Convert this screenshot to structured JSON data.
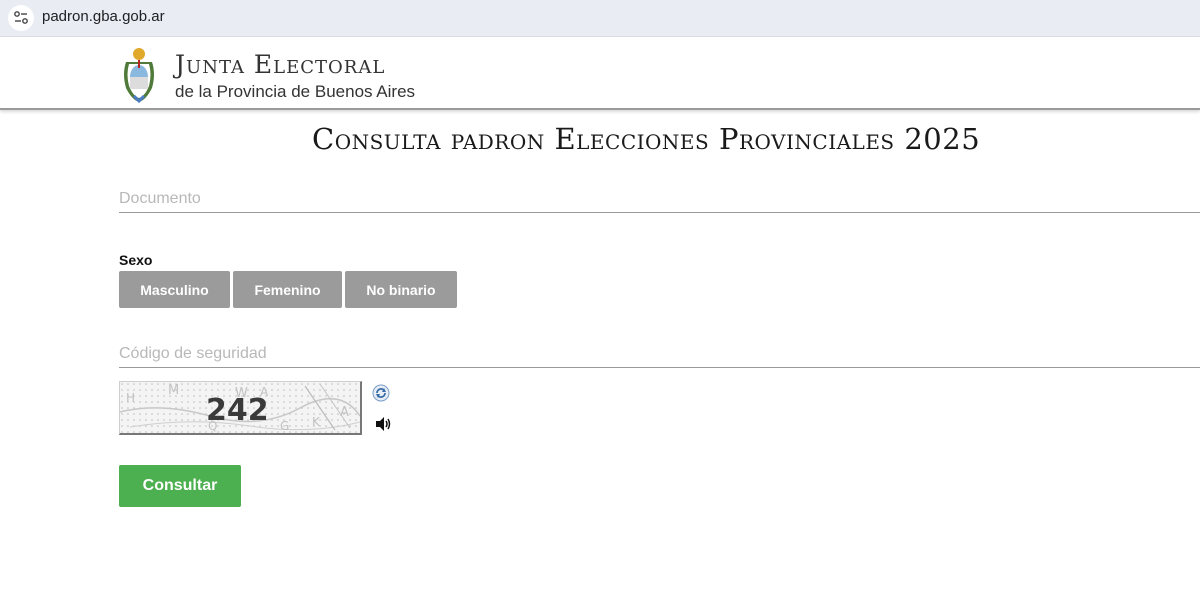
{
  "browser": {
    "url": "padron.gba.gob.ar",
    "site_info_icon": "tune-icon"
  },
  "header": {
    "brand_title": "Junta Electoral",
    "brand_subtitle": "de la Provincia de Buenos Aires",
    "emblem_icon": "coat-of-arms-icon"
  },
  "page": {
    "title": "Consulta padron Elecciones Provinciales 2025"
  },
  "form": {
    "documento": {
      "placeholder": "Documento",
      "value": ""
    },
    "sexo": {
      "label": "Sexo",
      "options": [
        "Masculino",
        "Femenino",
        "No binario"
      ]
    },
    "codigo": {
      "placeholder": "Código de seguridad",
      "value": ""
    },
    "captcha": {
      "text": "242",
      "noise_letters": [
        "M",
        "W",
        "A",
        "K",
        "G",
        "H",
        "Q",
        "A"
      ],
      "refresh_icon": "refresh-icon",
      "audio_icon": "speaker-icon"
    },
    "submit_label": "Consultar"
  },
  "colors": {
    "address_bar": "#e9ecf3",
    "sex_button": "#9b9b9b",
    "submit_button": "#4caf50"
  }
}
